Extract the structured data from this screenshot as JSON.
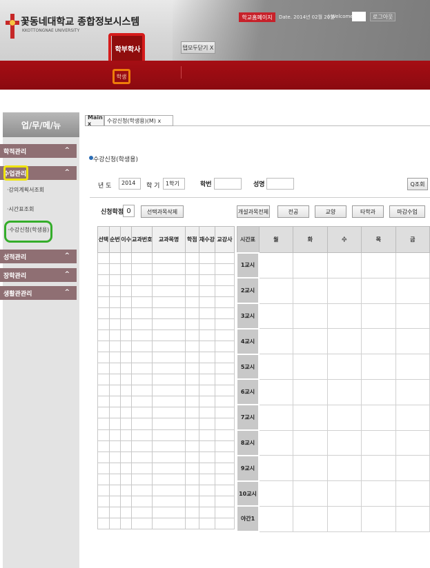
{
  "header": {
    "university_name": "꽃동네대학교 종합정보시스템",
    "university_eng": "KKOTTONGNAE UNIVERSITY",
    "nav_academic": "학부학사",
    "nav_link_tab": "탭모두닫기 X",
    "homepage_link": "학교홈페이지",
    "date_text": "Date. 2014년 02월 20일",
    "welcome_text": "| Welcome",
    "logout": "로그아웃",
    "sub_student": "학생"
  },
  "sidebar": {
    "title": "업/무/메/뉴",
    "categories": [
      {
        "label": "학적관리",
        "chevron": "^"
      },
      {
        "label": "수업관리",
        "chevron": "^"
      },
      {
        "label": "성적관리",
        "chevron": "^"
      },
      {
        "label": "장학관리",
        "chevron": "^"
      },
      {
        "label": "생활관관리",
        "chevron": "^"
      }
    ],
    "sub_items": [
      "·강의계획서조회",
      "·시간표조회",
      "·수강신청(학생용)"
    ]
  },
  "tabs": [
    {
      "label": "Main x"
    },
    {
      "label": "수강신청(학생용)(M) x"
    }
  ],
  "form": {
    "page_title": "수강신청(학생용)",
    "year_label": "년   도",
    "year_value": "2014",
    "term_label": "학   기",
    "term_value": "1학기",
    "student_id_label": "학번",
    "name_label": "성명",
    "search_button": "Q조회",
    "credit_label": "신청학점",
    "credit_value": "0",
    "delete_button": "선택과목삭제",
    "btn_all": "개설과목전체",
    "btn_major": "전공",
    "btn_liberal": "교양",
    "btn_other": "타학과",
    "btn_closed": "마감수업"
  },
  "course_table": {
    "headers": [
      "선택",
      "순번",
      "이수",
      "교과번호",
      "교과목명",
      "학점",
      "재수강",
      "교강사"
    ],
    "row_count": 25
  },
  "timetable": {
    "headers": [
      "시간표",
      "월",
      "화",
      "수",
      "목",
      "금"
    ],
    "periods": [
      "1교시",
      "2교시",
      "3교시",
      "4교시",
      "5교시",
      "6교시",
      "7교시",
      "8교시",
      "9교시",
      "10교시",
      "야간1"
    ]
  },
  "colors": {
    "brand_red": "#8f0d0d",
    "sidebar_category": "#8f6f73",
    "highlight_red": "#d51b1b",
    "highlight_orange": "#ee7d0a",
    "highlight_yellow": "#efe30d",
    "highlight_green": "#34ad2a"
  },
  "icons": {
    "logo": "university-logo-icon",
    "search": "search-icon"
  }
}
